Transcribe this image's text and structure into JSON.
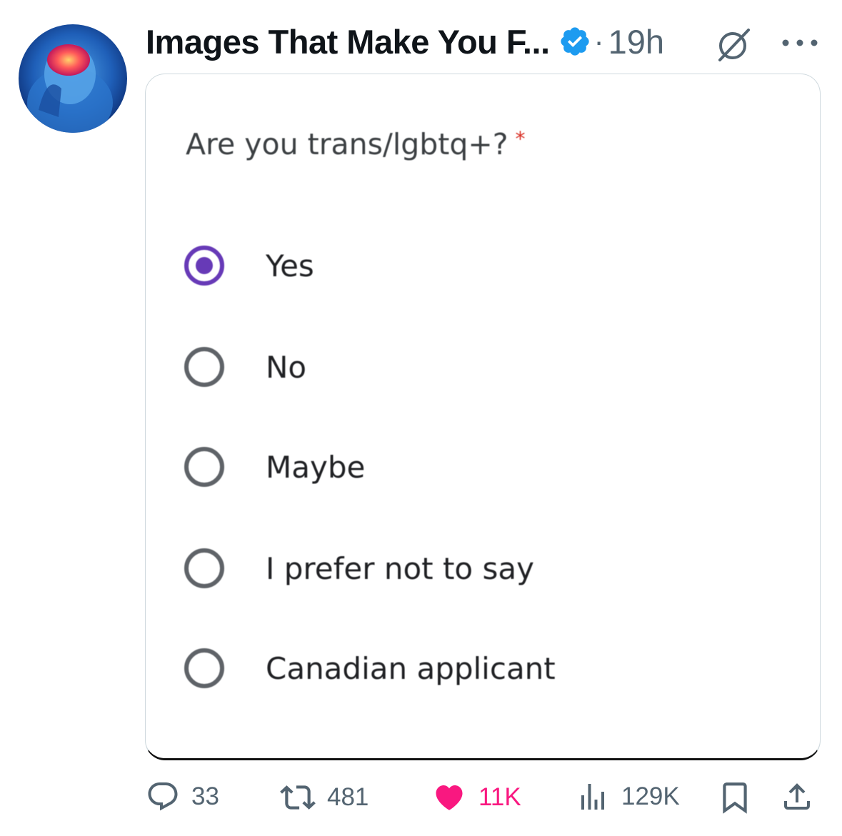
{
  "tweet": {
    "author": "Images That Make You F...",
    "separator": "·",
    "time": "19h"
  },
  "form": {
    "question": "Are you trans/lgbtq+?",
    "required_mark": "*",
    "options": [
      {
        "label": "Yes",
        "selected": true
      },
      {
        "label": "No",
        "selected": false
      },
      {
        "label": "Maybe",
        "selected": false
      },
      {
        "label": "I prefer not to say",
        "selected": false
      },
      {
        "label": "Canadian applicant",
        "selected": false
      }
    ],
    "accent_color": "#673ab7"
  },
  "actions": {
    "replies": "33",
    "reposts": "481",
    "likes": "11K",
    "views": "129K"
  },
  "icons": [
    "avatar",
    "verified-icon",
    "grok-icon",
    "more-icon",
    "reply-icon",
    "repost-icon",
    "heart-icon",
    "views-icon",
    "bookmark-icon",
    "share-icon"
  ],
  "colors": {
    "verified": "#1d9bf0",
    "like": "#f91880",
    "muted": "#536471"
  }
}
